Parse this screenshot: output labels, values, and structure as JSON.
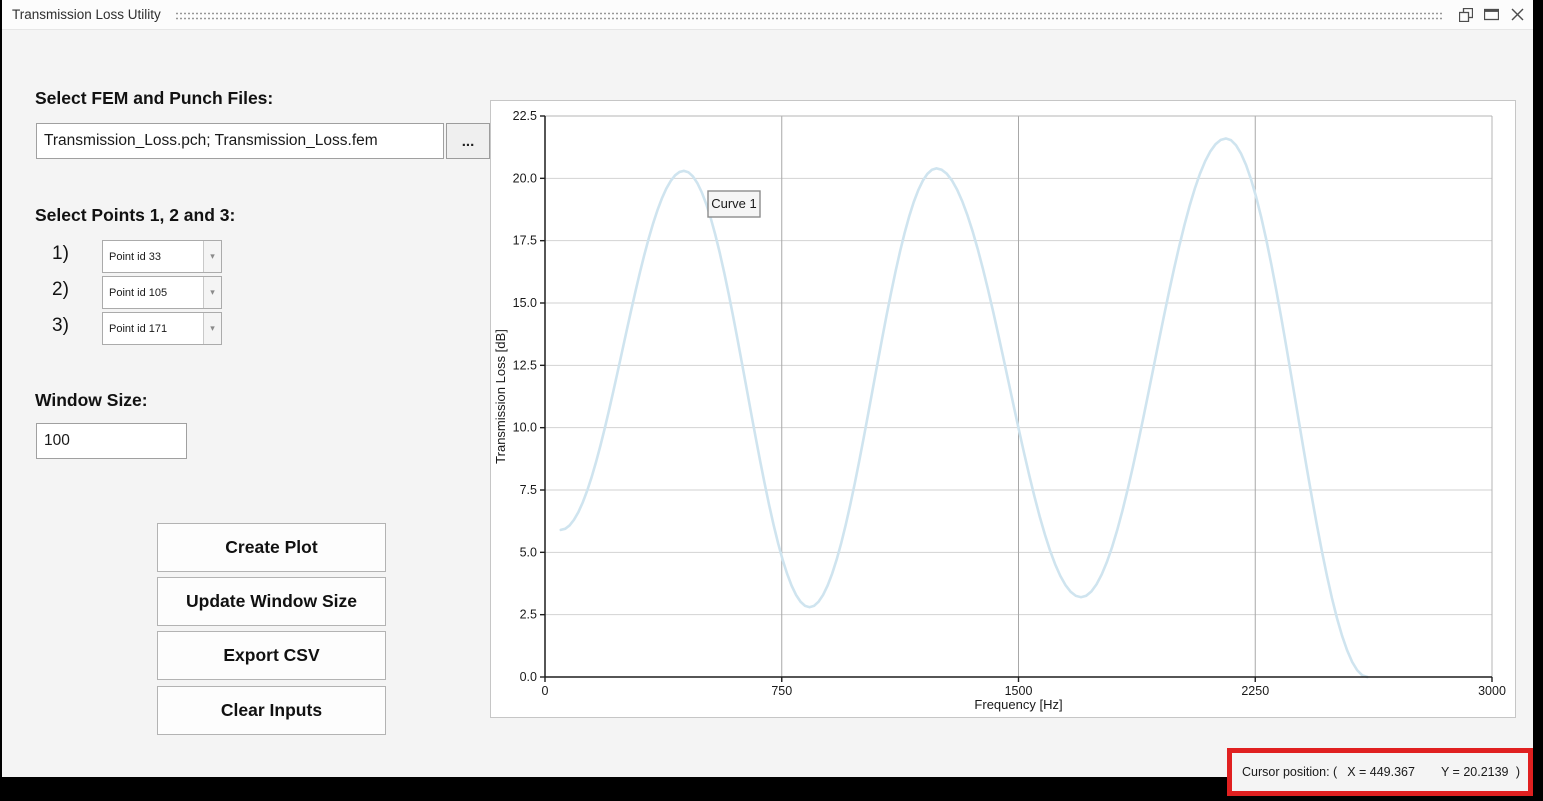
{
  "window": {
    "title": "Transmission Loss Utility",
    "controls": [
      "restore-icon",
      "maximize-icon",
      "close-icon"
    ]
  },
  "file_section": {
    "heading": "Select FEM and Punch Files:",
    "file_input_value": "Transmission_Loss.pch; Transmission_Loss.fem",
    "browse_label": "..."
  },
  "points_section": {
    "heading": "Select Points 1, 2 and 3:",
    "rows": [
      {
        "label": "1)",
        "value": "Point id 33"
      },
      {
        "label": "2)",
        "value": "Point id 105"
      },
      {
        "label": "3)",
        "value": "Point id 171"
      }
    ]
  },
  "window_size_section": {
    "heading": "Window Size:",
    "value": "100"
  },
  "actions": [
    {
      "label": "Create Plot"
    },
    {
      "label": "Update Window Size"
    },
    {
      "label": "Export CSV"
    },
    {
      "label": "Clear Inputs"
    }
  ],
  "status_bar": {
    "prefix": "Cursor position: (",
    "x_readout": "X = 449.367",
    "y_readout": "Y = 20.2139",
    "suffix": ")",
    "highlight_color": "#e02020"
  },
  "chart_data": {
    "type": "line",
    "title": "",
    "xlabel": "Frequency [Hz]",
    "ylabel": "Transmission Loss [dB]",
    "xlim": [
      0,
      3000
    ],
    "ylim": [
      0,
      22.5
    ],
    "x_tick_values": [
      0,
      750,
      1500,
      2250,
      3000
    ],
    "x_tick_labels": [
      "0",
      "750",
      "1500",
      "2250",
      "3000"
    ],
    "y_tick_values": [
      0,
      2.5,
      5,
      7.5,
      10,
      12.5,
      15,
      17.5,
      20,
      22.5
    ],
    "y_tick_labels": [
      "0.0",
      "2.5",
      "5.0",
      "7.5",
      "10.0",
      "12.5",
      "15.0",
      "17.5",
      "20.0",
      "22.5"
    ],
    "grid": true,
    "legend": {
      "label": "Curve 1",
      "position": "inside-top-left"
    },
    "series": [
      {
        "name": "Curve 1",
        "color": "#cfe4ef",
        "interpolation": "smooth",
        "points": [
          [
            50,
            5.9
          ],
          [
            440,
            20.3
          ],
          [
            838,
            2.8
          ],
          [
            1240,
            20.4
          ],
          [
            1698,
            3.2
          ],
          [
            2157,
            21.6
          ],
          [
            2605,
            0.0
          ]
        ]
      }
    ],
    "colors": {
      "h_grid": "#d2d2d2",
      "v_grid": "#a8a8a8",
      "axis": "#1f1f1f",
      "frame": "#b4b4b4",
      "tick_text": "#1a1a1a",
      "legend_border": "#8c8c8c",
      "legend_fill": "#f5f5f5"
    }
  }
}
